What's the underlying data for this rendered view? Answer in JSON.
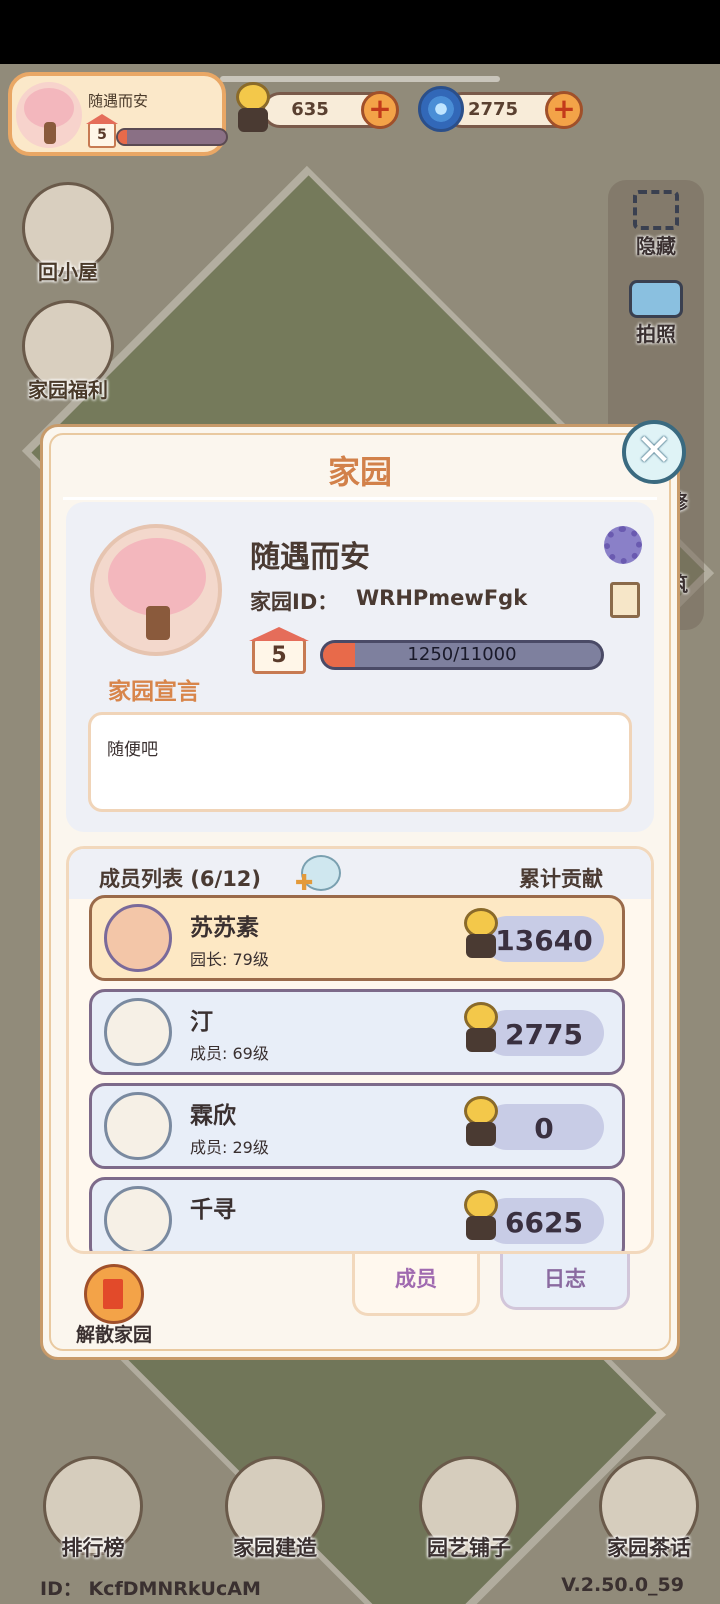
{
  "profile": {
    "name": "随遇而安",
    "level": "5",
    "progress": 0.08
  },
  "currencies": [
    {
      "icon": "snail-coin-icon",
      "value": "635"
    },
    {
      "icon": "swirl-gem-icon",
      "value": "2775"
    }
  ],
  "left_menu": [
    {
      "label": "回小屋",
      "icon": "house-icon"
    },
    {
      "label": "家园福利",
      "icon": "gift-icon"
    }
  ],
  "right_menu": [
    {
      "label": "隐藏",
      "icon": "hide-frame-icon"
    },
    {
      "label": "拍照",
      "icon": "camera-icon"
    },
    {
      "label": "修",
      "icon": "character-icon"
    },
    {
      "label": "筑",
      "icon": "build-icon"
    }
  ],
  "modal": {
    "title": "家园",
    "garden_name": "随遇而安",
    "garden_id_label": "家园ID：",
    "garden_id": "WRHPmewFgk",
    "level": "5",
    "exp_text": "1250/11000",
    "exp_fraction": 0.1136,
    "declaration_label": "家园宣言",
    "declaration_text": "随便吧",
    "members_title": "成员列表 (6/12)",
    "contribution_title": "累计贡献",
    "members": [
      {
        "name": "苏苏素",
        "role": "园长: 79级",
        "contribution": "13640",
        "avatar": "girl-avatar-icon"
      },
      {
        "name": "汀",
        "role": "成员: 69级",
        "contribution": "2775",
        "avatar": "cake-avatar-icon"
      },
      {
        "name": "霖欣",
        "role": "成员: 29级",
        "contribution": "0",
        "avatar": "tulip-avatar-icon"
      },
      {
        "name": "千寻",
        "role": "",
        "contribution": "6625",
        "avatar": "koi-avatar-icon"
      }
    ],
    "tabs": {
      "members": "成员",
      "log": "日志"
    },
    "dissolve_label": "解散家园"
  },
  "bottom_nav": [
    {
      "label": "排行榜",
      "icon": "leaderboard-icon"
    },
    {
      "label": "家园建造",
      "icon": "brick-trowel-icon"
    },
    {
      "label": "园艺铺子",
      "icon": "flower-pot-icon"
    },
    {
      "label": "家园茶话",
      "icon": "chat-bubbles-icon"
    }
  ],
  "footer": {
    "id": "ID：  KcfDMNRkUcAM",
    "version": "V.2.50.0_59"
  },
  "colors": {
    "accent_orange": "#d2814a",
    "exp_fill": "#e86a4a",
    "panel_lilac": "#eef0f6"
  }
}
